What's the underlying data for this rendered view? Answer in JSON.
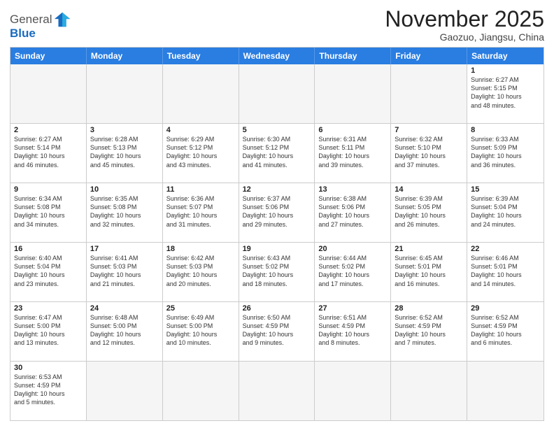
{
  "header": {
    "logo_general": "General",
    "logo_blue": "Blue",
    "month_title": "November 2025",
    "location": "Gaozuo, Jiangsu, China"
  },
  "days_of_week": [
    "Sunday",
    "Monday",
    "Tuesday",
    "Wednesday",
    "Thursday",
    "Friday",
    "Saturday"
  ],
  "rows": [
    [
      {
        "day": "",
        "text": "",
        "empty": true
      },
      {
        "day": "",
        "text": "",
        "empty": true
      },
      {
        "day": "",
        "text": "",
        "empty": true
      },
      {
        "day": "",
        "text": "",
        "empty": true
      },
      {
        "day": "",
        "text": "",
        "empty": true
      },
      {
        "day": "",
        "text": "",
        "empty": true
      },
      {
        "day": "1",
        "text": "Sunrise: 6:27 AM\nSunset: 5:15 PM\nDaylight: 10 hours\nand 48 minutes.",
        "empty": false
      }
    ],
    [
      {
        "day": "2",
        "text": "Sunrise: 6:27 AM\nSunset: 5:14 PM\nDaylight: 10 hours\nand 46 minutes.",
        "empty": false
      },
      {
        "day": "3",
        "text": "Sunrise: 6:28 AM\nSunset: 5:13 PM\nDaylight: 10 hours\nand 45 minutes.",
        "empty": false
      },
      {
        "day": "4",
        "text": "Sunrise: 6:29 AM\nSunset: 5:12 PM\nDaylight: 10 hours\nand 43 minutes.",
        "empty": false
      },
      {
        "day": "5",
        "text": "Sunrise: 6:30 AM\nSunset: 5:12 PM\nDaylight: 10 hours\nand 41 minutes.",
        "empty": false
      },
      {
        "day": "6",
        "text": "Sunrise: 6:31 AM\nSunset: 5:11 PM\nDaylight: 10 hours\nand 39 minutes.",
        "empty": false
      },
      {
        "day": "7",
        "text": "Sunrise: 6:32 AM\nSunset: 5:10 PM\nDaylight: 10 hours\nand 37 minutes.",
        "empty": false
      },
      {
        "day": "8",
        "text": "Sunrise: 6:33 AM\nSunset: 5:09 PM\nDaylight: 10 hours\nand 36 minutes.",
        "empty": false
      }
    ],
    [
      {
        "day": "9",
        "text": "Sunrise: 6:34 AM\nSunset: 5:08 PM\nDaylight: 10 hours\nand 34 minutes.",
        "empty": false
      },
      {
        "day": "10",
        "text": "Sunrise: 6:35 AM\nSunset: 5:08 PM\nDaylight: 10 hours\nand 32 minutes.",
        "empty": false
      },
      {
        "day": "11",
        "text": "Sunrise: 6:36 AM\nSunset: 5:07 PM\nDaylight: 10 hours\nand 31 minutes.",
        "empty": false
      },
      {
        "day": "12",
        "text": "Sunrise: 6:37 AM\nSunset: 5:06 PM\nDaylight: 10 hours\nand 29 minutes.",
        "empty": false
      },
      {
        "day": "13",
        "text": "Sunrise: 6:38 AM\nSunset: 5:06 PM\nDaylight: 10 hours\nand 27 minutes.",
        "empty": false
      },
      {
        "day": "14",
        "text": "Sunrise: 6:39 AM\nSunset: 5:05 PM\nDaylight: 10 hours\nand 26 minutes.",
        "empty": false
      },
      {
        "day": "15",
        "text": "Sunrise: 6:39 AM\nSunset: 5:04 PM\nDaylight: 10 hours\nand 24 minutes.",
        "empty": false
      }
    ],
    [
      {
        "day": "16",
        "text": "Sunrise: 6:40 AM\nSunset: 5:04 PM\nDaylight: 10 hours\nand 23 minutes.",
        "empty": false
      },
      {
        "day": "17",
        "text": "Sunrise: 6:41 AM\nSunset: 5:03 PM\nDaylight: 10 hours\nand 21 minutes.",
        "empty": false
      },
      {
        "day": "18",
        "text": "Sunrise: 6:42 AM\nSunset: 5:03 PM\nDaylight: 10 hours\nand 20 minutes.",
        "empty": false
      },
      {
        "day": "19",
        "text": "Sunrise: 6:43 AM\nSunset: 5:02 PM\nDaylight: 10 hours\nand 18 minutes.",
        "empty": false
      },
      {
        "day": "20",
        "text": "Sunrise: 6:44 AM\nSunset: 5:02 PM\nDaylight: 10 hours\nand 17 minutes.",
        "empty": false
      },
      {
        "day": "21",
        "text": "Sunrise: 6:45 AM\nSunset: 5:01 PM\nDaylight: 10 hours\nand 16 minutes.",
        "empty": false
      },
      {
        "day": "22",
        "text": "Sunrise: 6:46 AM\nSunset: 5:01 PM\nDaylight: 10 hours\nand 14 minutes.",
        "empty": false
      }
    ],
    [
      {
        "day": "23",
        "text": "Sunrise: 6:47 AM\nSunset: 5:00 PM\nDaylight: 10 hours\nand 13 minutes.",
        "empty": false
      },
      {
        "day": "24",
        "text": "Sunrise: 6:48 AM\nSunset: 5:00 PM\nDaylight: 10 hours\nand 12 minutes.",
        "empty": false
      },
      {
        "day": "25",
        "text": "Sunrise: 6:49 AM\nSunset: 5:00 PM\nDaylight: 10 hours\nand 10 minutes.",
        "empty": false
      },
      {
        "day": "26",
        "text": "Sunrise: 6:50 AM\nSunset: 4:59 PM\nDaylight: 10 hours\nand 9 minutes.",
        "empty": false
      },
      {
        "day": "27",
        "text": "Sunrise: 6:51 AM\nSunset: 4:59 PM\nDaylight: 10 hours\nand 8 minutes.",
        "empty": false
      },
      {
        "day": "28",
        "text": "Sunrise: 6:52 AM\nSunset: 4:59 PM\nDaylight: 10 hours\nand 7 minutes.",
        "empty": false
      },
      {
        "day": "29",
        "text": "Sunrise: 6:52 AM\nSunset: 4:59 PM\nDaylight: 10 hours\nand 6 minutes.",
        "empty": false
      }
    ],
    [
      {
        "day": "30",
        "text": "Sunrise: 6:53 AM\nSunset: 4:59 PM\nDaylight: 10 hours\nand 5 minutes.",
        "empty": false
      },
      {
        "day": "",
        "text": "",
        "empty": true
      },
      {
        "day": "",
        "text": "",
        "empty": true
      },
      {
        "day": "",
        "text": "",
        "empty": true
      },
      {
        "day": "",
        "text": "",
        "empty": true
      },
      {
        "day": "",
        "text": "",
        "empty": true
      },
      {
        "day": "",
        "text": "",
        "empty": true
      }
    ]
  ]
}
